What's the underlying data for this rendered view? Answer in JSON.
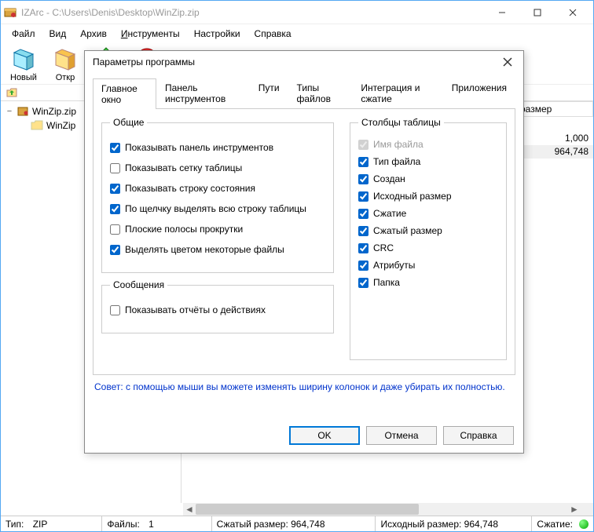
{
  "window": {
    "title": "IZArc - C:\\Users\\Denis\\Desktop\\WinZip.zip"
  },
  "menu": {
    "file": "Файл",
    "view": "Вид",
    "archive": "Архив",
    "tools_pre": "И",
    "tools_rest": "нструменты",
    "settings": "Настройки",
    "help": "Справка"
  },
  "toolbar": {
    "new": "Новый",
    "open": "Откр"
  },
  "tree": {
    "root": "WinZip.zip",
    "child": "WinZip"
  },
  "grid": {
    "col_size": "размер",
    "val1": "1,000",
    "val2": "964,748"
  },
  "status": {
    "type_label": "Тип:",
    "type_value": "ZIP",
    "files_label": "Файлы:",
    "files_value": "1",
    "compressed": "Сжатый размер: 964,748",
    "original": "Исходный размер: 964,748",
    "compression": "Сжатие:"
  },
  "dialog": {
    "title": "Параметры программы",
    "tabs": {
      "main": "Главное окно",
      "toolbar": "Панель инструментов",
      "paths": "Пути",
      "filetypes": "Типы файлов",
      "integration": "Интеграция и сжатие",
      "apps": "Приложения"
    },
    "general": {
      "legend": "Общие",
      "show_toolbar": "Показывать панель инструментов",
      "show_grid": "Показывать сетку таблицы",
      "show_status": "Показывать строку состояния",
      "click_select_row": "По щелчку выделять всю строку таблицы",
      "flat_scroll": "Плоские полосы прокрутки",
      "color_files": "Выделять цветом некоторые файлы"
    },
    "messages": {
      "legend": "Сообщения",
      "show_reports": "Показывать отчёты о действиях"
    },
    "columns": {
      "legend": "Столбцы таблицы",
      "filename": "Имя файла",
      "filetype": "Тип файла",
      "created": "Создан",
      "orig_size": "Исходный размер",
      "compression": "Сжатие",
      "compr_size": "Сжатый размер",
      "crc": "CRC",
      "attributes": "Атрибуты",
      "folder": "Папка"
    },
    "hint": "Совет: с помощью мыши вы можете изменять ширину колонок и даже убирать их полностью.",
    "ok": "OK",
    "cancel": "Отмена",
    "help": "Справка"
  }
}
